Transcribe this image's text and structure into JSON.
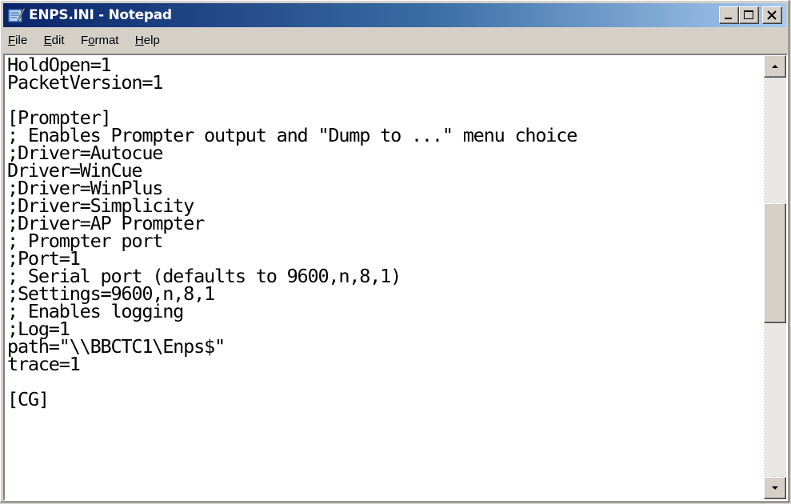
{
  "window": {
    "title": "ENPS.INI - Notepad",
    "app_icon": "notepad-icon"
  },
  "title_buttons": {
    "minimize": "minimize-icon",
    "maximize": "maximize-icon",
    "close": "close-icon"
  },
  "menu": [
    {
      "label": "File",
      "accel": "F",
      "rest": "ile"
    },
    {
      "label": "Edit",
      "accel": "E",
      "rest": "dit"
    },
    {
      "label": "Format",
      "pre": "F",
      "accel": "o",
      "rest": "rmat"
    },
    {
      "label": "Help",
      "accel": "H",
      "rest": "elp"
    }
  ],
  "editor": {
    "lines": [
      "HoldOpen=1",
      "PacketVersion=1",
      "",
      "[Prompter]",
      "; Enables Prompter output and \"Dump to ...\" menu choice",
      ";Driver=Autocue",
      "Driver=WinCue",
      ";Driver=WinPlus",
      ";Driver=Simplicity",
      ";Driver=AP Prompter",
      "; Prompter port",
      ";Port=1",
      "; Serial port (defaults to 9600,n,8,1)",
      ";Settings=9600,n,8,1",
      "; Enables logging",
      ";Log=1",
      "path=\"\\\\BBCTC1\\Enps$\"",
      "trace=1",
      "",
      "[CG]"
    ]
  },
  "scrollbar": {
    "up_icon": "scroll-up-arrow-icon",
    "down_icon": "scroll-down-arrow-icon",
    "thumb_position_fraction": 0.45
  },
  "colors": {
    "title_gradient_start": "#0a246a",
    "title_gradient_end": "#a6caf0",
    "chrome": "#d4d0c8"
  }
}
